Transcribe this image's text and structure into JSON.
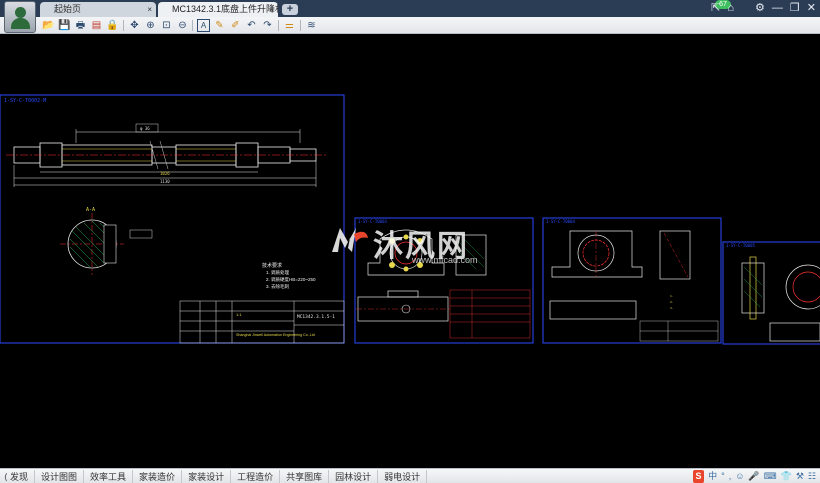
{
  "tabs": [
    {
      "label": "起始页",
      "close": "×"
    },
    {
      "label": "MC1342.3.1底盘上件升降机...",
      "close": "×"
    }
  ],
  "new_tab_label": "+",
  "window": {
    "badge": "67",
    "controls": [
      "⇱",
      "⌂",
      "⚙",
      "—",
      "❐",
      "✕"
    ]
  },
  "toolbar": {
    "icons": [
      "open-icon",
      "save-icon",
      "print-icon",
      "pdf-icon",
      "lock-icon",
      "pan-icon",
      "zoom-in-icon",
      "zoom-window-icon",
      "zoom-out-icon",
      "zoom-extents-icon",
      "text-icon",
      "pen-icon",
      "highlight-icon",
      "undo-icon",
      "redo-icon",
      "measure-icon",
      "layer-icon"
    ],
    "glyphs": [
      "📂",
      "💾",
      "🖶",
      "▤",
      "🔒",
      "✥",
      "⊕",
      "⊡",
      "⊖",
      "⤢",
      "A",
      "✎",
      "✐",
      "↶",
      "↷",
      "⚌",
      "≋"
    ]
  },
  "drawing": {
    "frame1": {
      "tag": "1-SY-C-T0002-M",
      "title_no": "MC1342.3.1.5-1",
      "note_head": "技术要求",
      "notes": [
        "1. 调质处理",
        "2. 调质硬度HB=220~250",
        "3. 去除毛刺"
      ],
      "company": "Shanghai Jinwell Automation Engineering Co.,Ltd",
      "scale": "1:1"
    },
    "frame2": {
      "tag": "1-SY-C-T0003"
    },
    "frame3": {
      "tag": "1-SY-C-T0004"
    },
    "frame4": {
      "tag": "1-SY-C-T0005"
    }
  },
  "watermark": {
    "text": "沐风网",
    "url": "www.mfcad.com"
  },
  "bottom_nav": [
    "⟨ 发现",
    "设计图图",
    "效率工具",
    "家装造价",
    "家装设计",
    "工程造价",
    "共享图库",
    "园林设计",
    "弱电设计"
  ],
  "tray": [
    "S",
    "中",
    "°",
    ",",
    "☺",
    "🎤",
    "⌨",
    "👕",
    "⚒",
    "☷"
  ]
}
